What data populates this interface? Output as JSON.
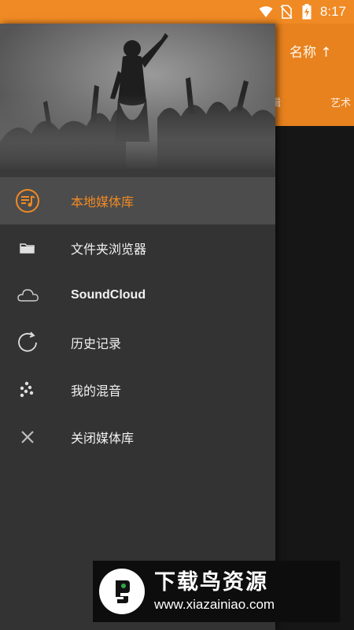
{
  "status_bar": {
    "time": "8:17",
    "icons": [
      "wifi-icon",
      "no-sim-icon",
      "battery-charging-icon"
    ],
    "color": "#f08a24"
  },
  "background_app": {
    "sort_label": "名称 ↑",
    "columns": [
      "辑",
      "艺术"
    ],
    "accent": "#e8821e"
  },
  "drawer": {
    "header_image": "concert-crowd-image",
    "items": [
      {
        "label": "本地媒体库",
        "icon": "playlist-icon",
        "active": true
      },
      {
        "label": "文件夹浏览器",
        "icon": "folder-icon",
        "active": false
      },
      {
        "label": "SoundCloud",
        "icon": "cloud-icon",
        "active": false
      },
      {
        "label": "历史记录",
        "icon": "history-icon",
        "active": false
      },
      {
        "label": "我的混音",
        "icon": "mix-icon",
        "active": false
      },
      {
        "label": "关闭媒体库",
        "icon": "close-icon",
        "active": false
      }
    ],
    "active_color": "#f08a24"
  },
  "watermark": {
    "title": "下载鸟资源",
    "url": "www.xiazainiao.com"
  }
}
